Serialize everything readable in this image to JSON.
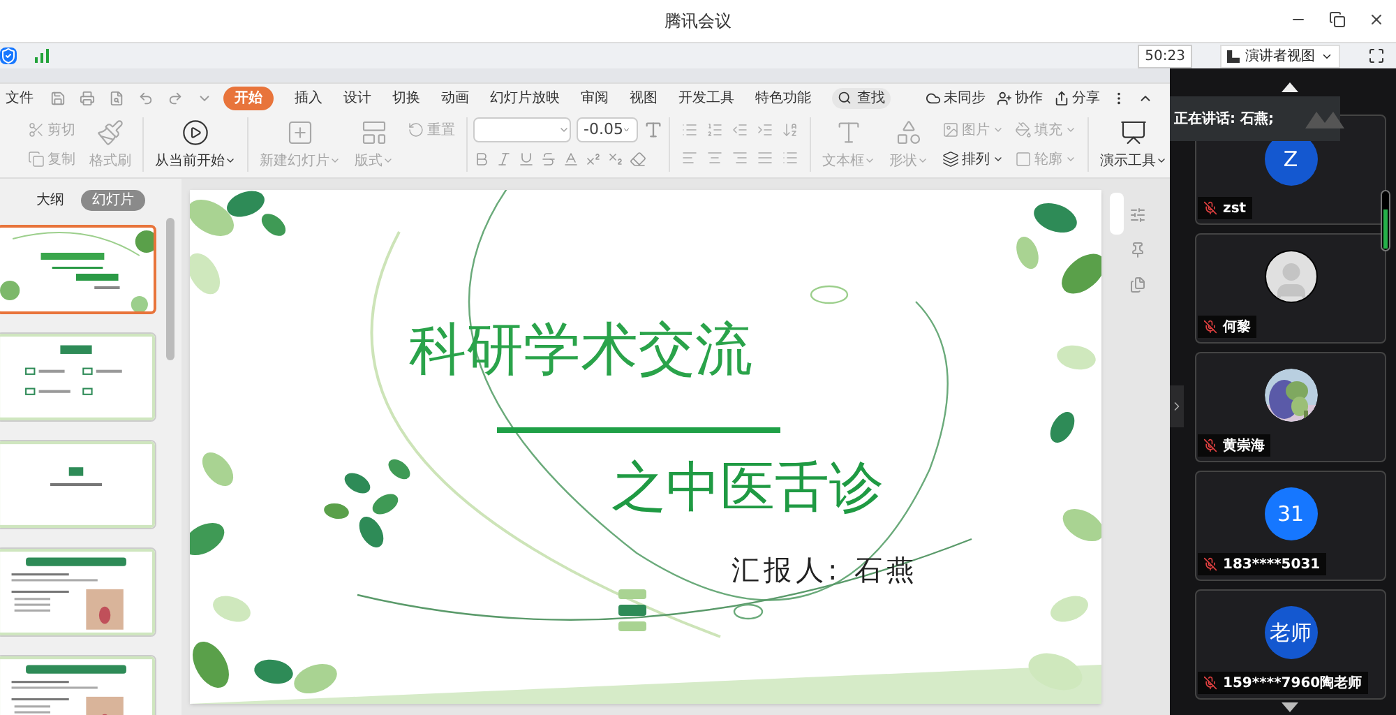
{
  "window": {
    "title": "腾讯会议"
  },
  "meeting_bar": {
    "timer": "50:23",
    "view_button": "演讲者视图"
  },
  "presentation": {
    "file_menu": "文件",
    "tabs": [
      {
        "label": "开始",
        "selected": true
      },
      {
        "label": "插入",
        "selected": false
      },
      {
        "label": "设计",
        "selected": false
      },
      {
        "label": "切换",
        "selected": false
      },
      {
        "label": "动画",
        "selected": false
      },
      {
        "label": "幻灯片放映",
        "selected": false
      },
      {
        "label": "审阅",
        "selected": false
      },
      {
        "label": "视图",
        "selected": false
      },
      {
        "label": "开发工具",
        "selected": false
      },
      {
        "label": "特色功能",
        "selected": false
      }
    ],
    "search": "查找",
    "actions": [
      "未同步",
      "协作",
      "分享"
    ],
    "ribbon": [
      {
        "tools": [
          {
            "label": "剪切",
            "kind": "small",
            "disabled": true,
            "dropdown": false
          },
          {
            "label": "复制",
            "kind": "small",
            "disabled": true,
            "dropdown": false
          },
          {
            "label": "格式刷",
            "kind": "large",
            "disabled": true,
            "dropdown": false
          }
        ]
      },
      {
        "tools": [
          {
            "label": "从当前开始",
            "kind": "large",
            "disabled": false,
            "dropdown": true
          }
        ]
      },
      {
        "tools": [
          {
            "label": "新建幻灯片",
            "kind": "large",
            "disabled": true,
            "dropdown": true
          },
          {
            "label": "版式",
            "kind": "large",
            "disabled": true,
            "dropdown": true
          },
          {
            "label": "重置",
            "kind": "small",
            "disabled": true,
            "dropdown": false
          }
        ]
      },
      {
        "kind": "font",
        "font_size": "-0.05"
      },
      {
        "kind": "paragraph"
      },
      {
        "tools": [
          {
            "label": "文本框",
            "kind": "large",
            "disabled": true,
            "dropdown": true
          },
          {
            "label": "形状",
            "kind": "large",
            "disabled": true,
            "dropdown": true
          },
          {
            "label": "图片",
            "kind": "small",
            "disabled": true,
            "dropdown": true
          },
          {
            "label": "排列",
            "kind": "small",
            "disabled": false,
            "dropdown": true
          },
          {
            "label": "填充",
            "kind": "small",
            "disabled": true,
            "dropdown": true
          },
          {
            "label": "轮廓",
            "kind": "small",
            "disabled": true,
            "dropdown": true
          }
        ]
      },
      {
        "tools": [
          {
            "label": "演示工具",
            "kind": "large",
            "disabled": false,
            "dropdown": true
          }
        ]
      }
    ],
    "pane_tabs": [
      {
        "label": "大纲",
        "selected": false
      },
      {
        "label": "幻灯片",
        "selected": true
      }
    ],
    "thumbnails": [
      {
        "kind": "title",
        "selected": true
      },
      {
        "kind": "contents",
        "selected": false
      },
      {
        "kind": "section",
        "selected": false
      },
      {
        "kind": "text_image",
        "selected": false
      },
      {
        "kind": "text_image",
        "selected": false
      }
    ],
    "slide": {
      "title": "科研学术交流",
      "subtitle": "之中医舌诊",
      "reporter": "汇报人: 石燕"
    }
  },
  "participants_panel": {
    "speaking": "正在讲话: 石燕;",
    "participants": [
      {
        "name": "zst",
        "kind": "initial",
        "initial": "Z",
        "muted": true
      },
      {
        "name": "何黎",
        "kind": "silhouette",
        "muted": true
      },
      {
        "name": "黄崇海",
        "kind": "picture",
        "muted": true
      },
      {
        "name": "183****5031",
        "kind": "initial",
        "initial": "31",
        "muted": true
      },
      {
        "name": "159****7960陶老师",
        "kind": "initial",
        "initial": "老师",
        "muted": true
      }
    ]
  }
}
